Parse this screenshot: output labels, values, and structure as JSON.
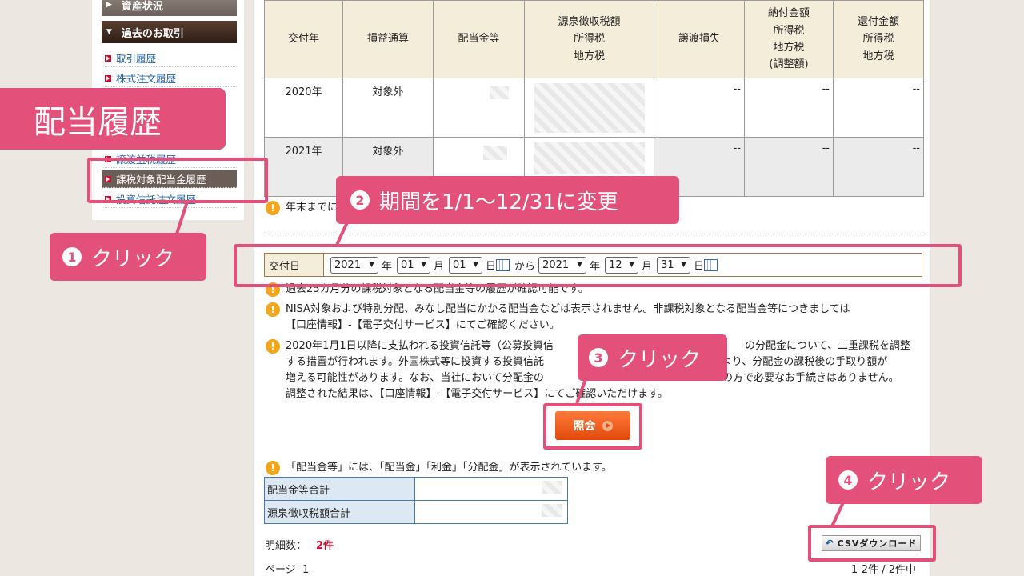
{
  "sidebar": {
    "head_assets": "資産状況",
    "head_past": "過去のお取引",
    "items": [
      {
        "label": "取引履歴"
      },
      {
        "label": "株式注文履歴"
      },
      {
        "label": "譲渡益税履歴"
      },
      {
        "label": "課税対象配当金履歴"
      },
      {
        "label": "投資信託注文履歴"
      }
    ]
  },
  "table": {
    "headers": [
      "交付年",
      "損益通算",
      "配当金等",
      "源泉徴収税額\n所得税\n地方税",
      "譲渡損失",
      "納付金額\n所得税\n地方税\n(調整額)",
      "還付金額\n所得税\n地方税"
    ],
    "rows": [
      {
        "year": "2020年",
        "netting": "対象外",
        "loss": "--",
        "payment": "--",
        "refund": "--"
      },
      {
        "year": "2021年",
        "netting": "対象外",
        "loss": "--",
        "payment": "--",
        "refund": "--"
      }
    ]
  },
  "notes": {
    "year_end": "年末までに",
    "past_25": "過去25カ月分の課税対象となる配当金等の履歴が確認可能です。",
    "nisa": "NISA対象および特別分配、みなし配当にかかる配当金などは表示されません。非課税対象となる配当金等につきましては\n【口座情報】-【電子交付サービス】にてご確認ください。",
    "fund_line1": "2020年1月1日以降に支払われる投資信託等（公募投資信",
    "fund_line1b": "の分配金について、二重課税を調整",
    "fund_line2": "する措置が行われます。外国株式等に投資する投資信託",
    "fund_line2b": "により、分配金の課税後の手取り額が",
    "fund_line3": "増える可能性があります。なお、当社において分配金の",
    "fund_line3b": "の方で必要なお手続きはありません。",
    "fund_line4": "調整された結果は、【口座情報】-【電子交付サービス】にてご確認いただけます。",
    "dividend_def": "「配当金等」には、「配当金」「利金」「分配金」が表示されています。"
  },
  "date_filter": {
    "label": "交付日",
    "from_year": "2021",
    "from_month": "01",
    "from_day": "01",
    "to_year": "2021",
    "to_month": "12",
    "to_day": "31",
    "unit_year": "年",
    "unit_month": "月",
    "unit_day": "日",
    "from_to": "から"
  },
  "search_button": "照会",
  "totals": [
    {
      "label": "配当金等合計"
    },
    {
      "label": "源泉徴収税額合計"
    }
  ],
  "count_label": "明細数：",
  "count_value": "2件",
  "page_label": "ページ  1",
  "range_label": "1-2件 / 2件中",
  "csv_button": "CSVダウンロード",
  "overlays": {
    "title": "配当履歴",
    "step1": "クリック",
    "step2": "期間を1/1〜12/31に変更",
    "step3": "クリック",
    "step4": "クリック",
    "n1": "1",
    "n2": "2",
    "n3": "3",
    "n4": "4"
  },
  "colors": {
    "accent": "#e3517a",
    "warn": "#f3a51c",
    "button": "#e04a0a"
  }
}
